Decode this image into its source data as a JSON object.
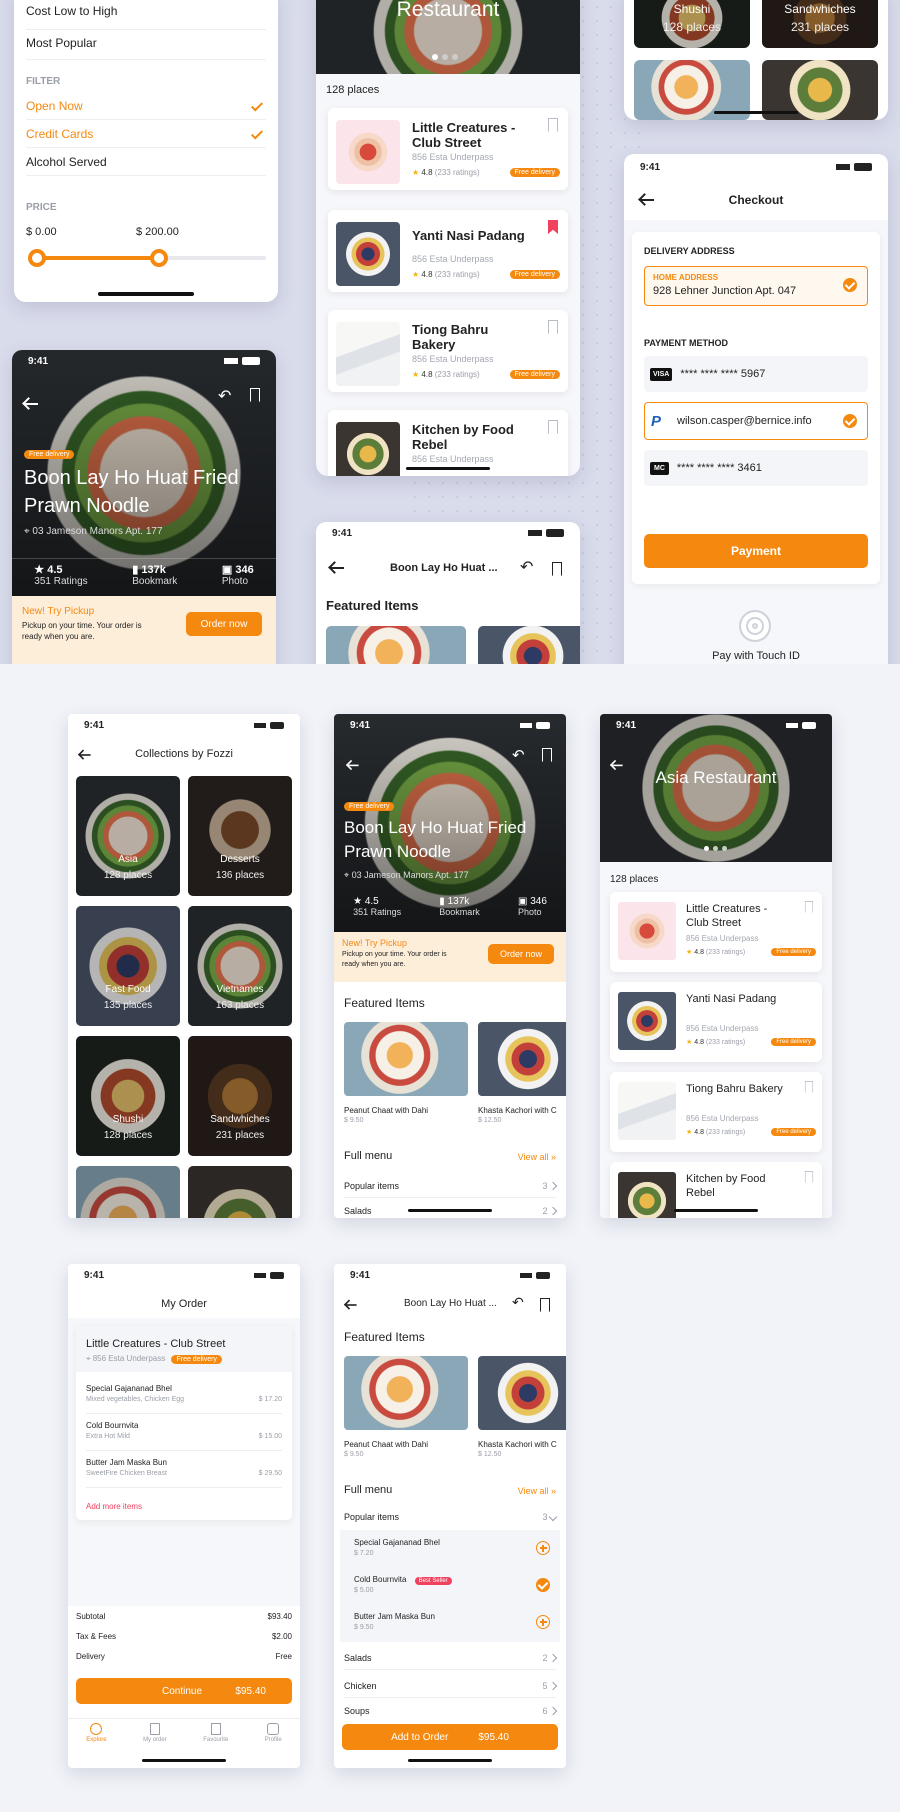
{
  "sort": {
    "items": [
      "Cost Low to High",
      "Most Popular"
    ],
    "filter_label": "FILTER",
    "filters": [
      {
        "label": "Open Now",
        "active": true
      },
      {
        "label": "Credit Cards",
        "active": true
      },
      {
        "label": "Alcohol Served",
        "active": false
      }
    ],
    "price_label": "PRICE",
    "price_min": "$ 0.00",
    "price_max": "$ 200.00"
  },
  "restaurant_list": {
    "banner_title": "Restaurant",
    "banner_title_full": "Asia Restaurant",
    "places": "128 places",
    "items": [
      {
        "name": "Little Creatures - Club Street",
        "address": "856 Esta Underpass",
        "rating": "4.8",
        "ratings": "(233 ratings)",
        "tag": "Free delivery",
        "bookmarked": false
      },
      {
        "name": "Yanti Nasi Padang",
        "address": "856 Esta Underpass",
        "rating": "4.8",
        "ratings": "(233 ratings)",
        "tag": "Free delivery",
        "bookmarked": true
      },
      {
        "name": "Tiong Bahru Bakery",
        "address": "856 Esta Underpass",
        "rating": "4.8",
        "ratings": "(233 ratings)",
        "tag": "Free delivery",
        "bookmarked": false
      },
      {
        "name": "Kitchen by Food Rebel",
        "address": "856 Esta Underpass",
        "rating": "4.8",
        "ratings": "(233 ratings)",
        "tag": "Free delivery",
        "bookmarked": false
      }
    ]
  },
  "collections_top": [
    {
      "name": "Shushi",
      "places": "128 places"
    },
    {
      "name": "Sandwhiches",
      "places": "231 places"
    }
  ],
  "checkout": {
    "time": "9:41",
    "title": "Checkout",
    "delivery_label": "DELIVERY ADDRESS",
    "home_label": "HOME ADDRESS",
    "address": "928 Lehner Junction Apt. 047",
    "payment_label": "PAYMENT METHOD",
    "methods": [
      {
        "brand": "VISA",
        "value": "**** **** **** 5967",
        "selected": false
      },
      {
        "brand": "P",
        "value": "wilson.casper@bernice.info",
        "selected": true
      },
      {
        "brand": "MC",
        "value": "**** **** **** 3461",
        "selected": false
      }
    ],
    "pay_button": "Payment",
    "touch_id": "Pay with Touch ID"
  },
  "detail": {
    "time": "9:41",
    "tag": "Free delivery",
    "name": "Boon Lay Ho Huat Fried Prawn Noodle",
    "name_short": "Boon Lay Ho Huat ...",
    "address": "03 Jameson Manors Apt. 177",
    "stats": [
      {
        "value": "4.5",
        "label": "351 Ratings"
      },
      {
        "value": "137k",
        "label": "Bookmark"
      },
      {
        "value": "346",
        "label": "Photo"
      }
    ],
    "pickup_title": "New! Try Pickup",
    "pickup_text": "Pickup on your time. Your order is ready when you are.",
    "order_now": "Order now"
  },
  "featured": {
    "title": "Featured Items",
    "items": [
      {
        "name": "Peanut Chaat with Dahi",
        "price": "$ 9.50"
      },
      {
        "name": "Khasta Kachori with C",
        "price": "$ 12.50"
      }
    ],
    "full_menu": "Full menu",
    "view_all": "View all",
    "menu": [
      {
        "name": "Popular items",
        "count": "3"
      },
      {
        "name": "Salads",
        "count": "2"
      },
      {
        "name": "Chicken",
        "count": "5"
      },
      {
        "name": "Soups",
        "count": "6"
      }
    ],
    "popular": [
      {
        "name": "Special Gajananad Bhel",
        "price": "$ 7.20",
        "badge": "",
        "added": false
      },
      {
        "name": "Cold Bournvita",
        "price": "$ 5.00",
        "badge": "Best Seller",
        "added": true
      },
      {
        "name": "Butter Jam Maska Bun",
        "price": "$ 9.50",
        "badge": "",
        "added": false
      }
    ],
    "add_to_order": "Add to Order",
    "add_total": "$95.40"
  },
  "collections": {
    "time": "9:41",
    "title": "Collections by Fozzi",
    "tiles": [
      {
        "name": "Asia",
        "places": "128 places"
      },
      {
        "name": "Desserts",
        "places": "136 places"
      },
      {
        "name": "Fast Food",
        "places": "135 places"
      },
      {
        "name": "Vietnames",
        "places": "163 places"
      },
      {
        "name": "Shushi",
        "places": "128 places"
      },
      {
        "name": "Sandwhiches",
        "places": "231 places"
      }
    ]
  },
  "my_order": {
    "time": "9:41",
    "title": "My Order",
    "restaurant": "Little Creatures - Club Street",
    "tag": "Free delivery",
    "address": "856 Esta Underpass",
    "items": [
      {
        "name": "Special Gajananad Bhel",
        "desc": "Mixed vegetables, Chicken Egg",
        "price": "$ 17.20"
      },
      {
        "name": "Cold Bournvita",
        "desc": "Extra Hot Mild",
        "price": "$ 15.00"
      },
      {
        "name": "Butter Jam Maska Bun",
        "desc": "SweetFire Chicken Breast",
        "price": "$ 29.50"
      }
    ],
    "add_more": "Add more items",
    "subtotal_label": "Subtotal",
    "subtotal": "$93.40",
    "tax_label": "Tax & Fees",
    "tax": "$2.00",
    "delivery_label": "Delivery",
    "delivery": "Free",
    "continue": "Continue",
    "total": "$95.40",
    "tabs": [
      "Explore",
      "My order",
      "Favourite",
      "Profile"
    ]
  },
  "colors": {
    "accent": "#f5890f",
    "bookmark": "#f0415e"
  }
}
